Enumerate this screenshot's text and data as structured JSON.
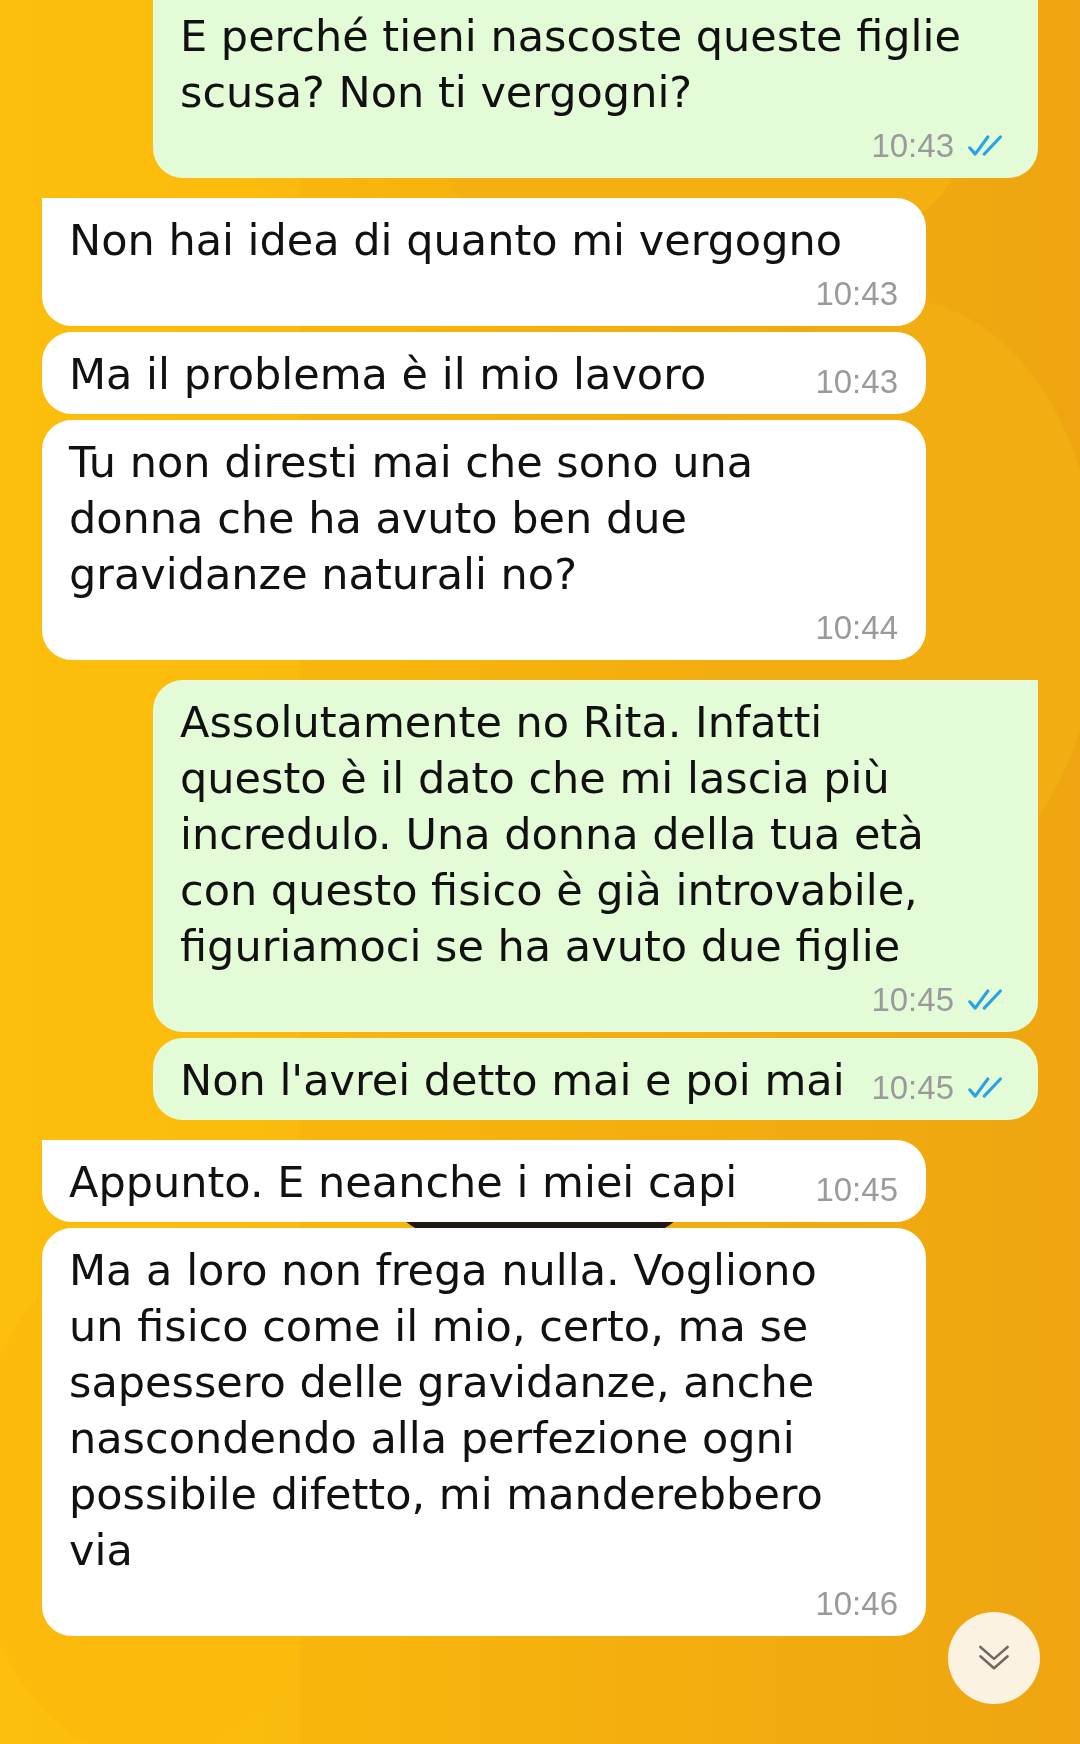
{
  "messages": [
    {
      "kind": "outgoing",
      "tail": false,
      "text": "E perché tieni nascoste queste figlie scusa? Non ti vergogni?",
      "time": "10:43",
      "read": true
    },
    {
      "kind": "incoming",
      "tail": true,
      "text": "Non hai idea di quanto mi vergogno",
      "time": "10:43"
    },
    {
      "kind": "incoming",
      "tail": false,
      "text": "Ma il problema è il mio lavoro",
      "time": "10:43"
    },
    {
      "kind": "incoming",
      "tail": false,
      "text": "Tu non diresti mai che sono una donna che ha avuto ben due gravidanze naturali no?",
      "time": "10:44"
    },
    {
      "kind": "outgoing",
      "tail": true,
      "text": "Assolutamente no Rita. Infatti questo è il dato che mi lascia più incredulo. Una donna della tua età con questo fisico è già introvabile, figuriamoci se ha avuto due figlie",
      "time": "10:45",
      "read": true
    },
    {
      "kind": "outgoing",
      "tail": false,
      "text": "Non l'avrei detto mai e poi mai",
      "time": "10:45",
      "read": true
    },
    {
      "kind": "incoming",
      "tail": true,
      "text": "Appunto. E neanche i miei capi",
      "time": "10:45"
    },
    {
      "kind": "incoming",
      "tail": false,
      "text": "Ma a loro non frega nulla. Vogliono un fisico come il mio, certo, ma se sapessero delle gravidanze, anche nascondendo alla perfezione ogni possibile difetto, mi manderebbero via",
      "time": "10:46"
    }
  ]
}
